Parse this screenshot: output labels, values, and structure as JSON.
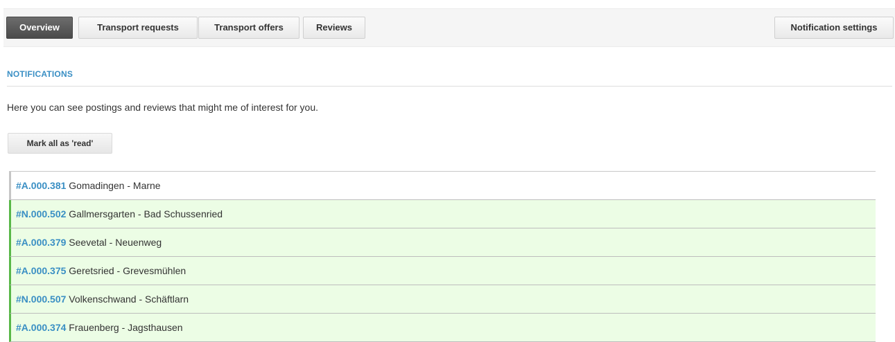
{
  "toolbar": {
    "tabs": [
      {
        "label": "Overview",
        "active": true
      },
      {
        "label": "Transport requests",
        "active": false
      },
      {
        "label": "Transport offers",
        "active": false
      },
      {
        "label": "Reviews",
        "active": false
      }
    ],
    "settings_label": "Notification settings"
  },
  "notifications": {
    "title": "NOTIFICATIONS",
    "intro": "Here you can see postings and reviews that might me of interest for you.",
    "mark_all_label": "Mark all as 'read'",
    "items": [
      {
        "ref": "#A.000.381",
        "route": "Gomadingen - Marne",
        "unread": false
      },
      {
        "ref": "#N.000.502",
        "route": "Gallmersgarten - Bad Schussenried",
        "unread": true
      },
      {
        "ref": "#A.000.379",
        "route": "Seevetal - Neuenweg",
        "unread": true
      },
      {
        "ref": "#A.000.375",
        "route": "Geretsried - Grevesmühlen",
        "unread": true
      },
      {
        "ref": "#N.000.507",
        "route": "Volkenschwand - Schäftlarn",
        "unread": true
      },
      {
        "ref": "#A.000.374",
        "route": "Frauenberg - Jagsthausen",
        "unread": true
      }
    ]
  },
  "colors": {
    "accent": "#3a8fc4",
    "unread_bg": "#ecfde5",
    "unread_border": "#59b848",
    "active_tab": "#4a4a4a"
  }
}
